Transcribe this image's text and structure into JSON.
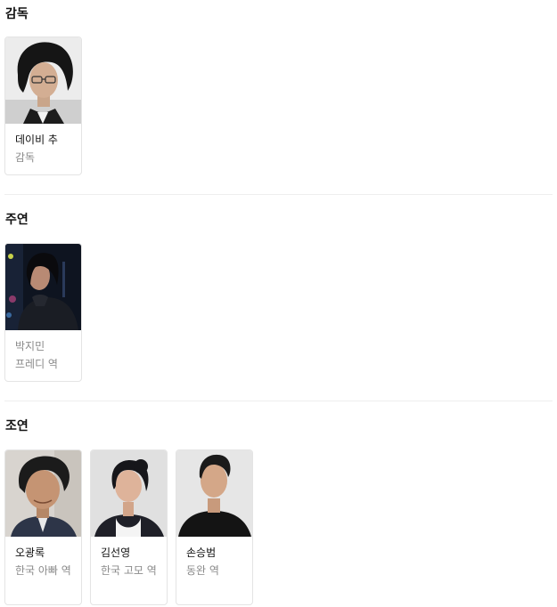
{
  "sections": [
    {
      "title": "감독",
      "people": [
        {
          "name": "데이비 추",
          "role": "감독",
          "photo": "person-portrait-icon"
        }
      ]
    },
    {
      "title": "주연",
      "people": [
        {
          "name": "박지민",
          "role": "프레디 역",
          "photo": "person-portrait-icon"
        }
      ]
    },
    {
      "title": "조연",
      "people": [
        {
          "name": "오광록",
          "role": "한국 아빠 역",
          "photo": "person-portrait-icon"
        },
        {
          "name": "김선영",
          "role": "한국 고모 역",
          "photo": "person-portrait-icon"
        },
        {
          "name": "손승범",
          "role": "동완 역",
          "photo": "person-portrait-icon"
        }
      ]
    }
  ],
  "colors": {
    "divider": "#eeeeee",
    "card_border": "#e4e4e4",
    "muted_text": "#8a8a8a"
  }
}
